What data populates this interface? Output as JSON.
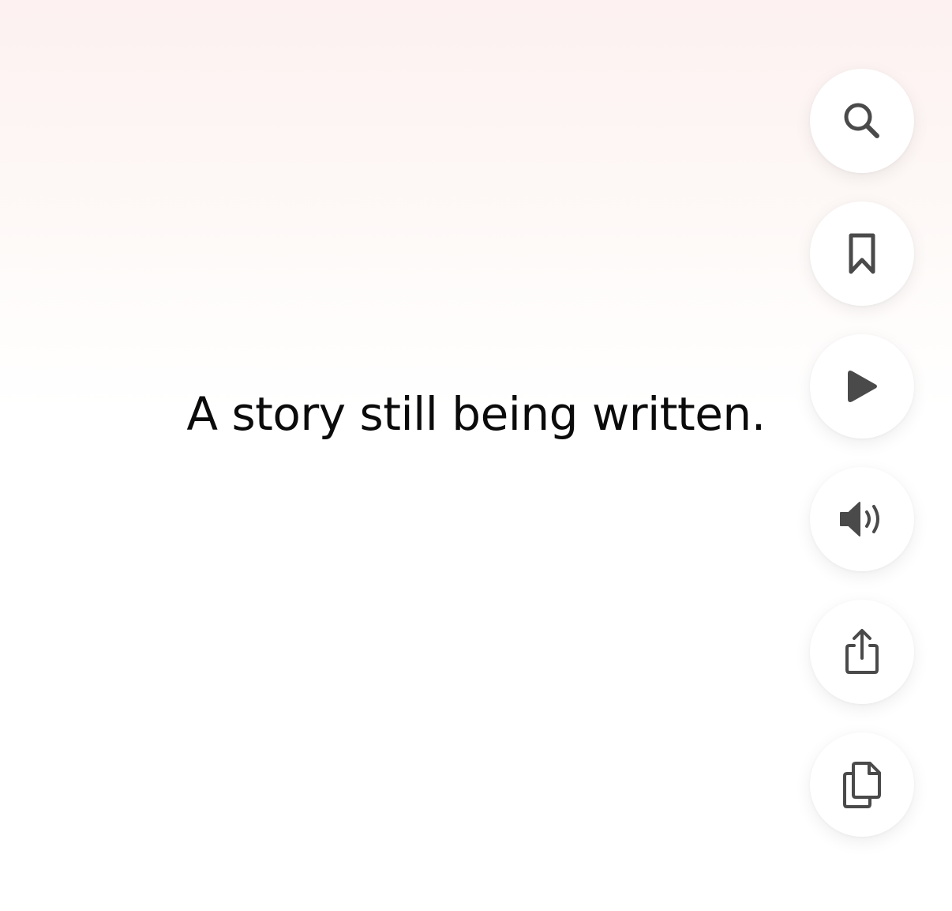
{
  "content": {
    "quote_text": "A story still being written."
  },
  "actions": [
    {
      "id": "search",
      "icon": "search-icon"
    },
    {
      "id": "bookmark",
      "icon": "bookmark-icon"
    },
    {
      "id": "play",
      "icon": "play-icon"
    },
    {
      "id": "speaker",
      "icon": "speaker-icon"
    },
    {
      "id": "share",
      "icon": "share-icon"
    },
    {
      "id": "copy",
      "icon": "copy-icon"
    }
  ],
  "colors": {
    "icon": "#4a4a4a",
    "text": "#0b0b0b",
    "button_bg": "#ffffff",
    "top_tint": "#fdf1f1"
  }
}
